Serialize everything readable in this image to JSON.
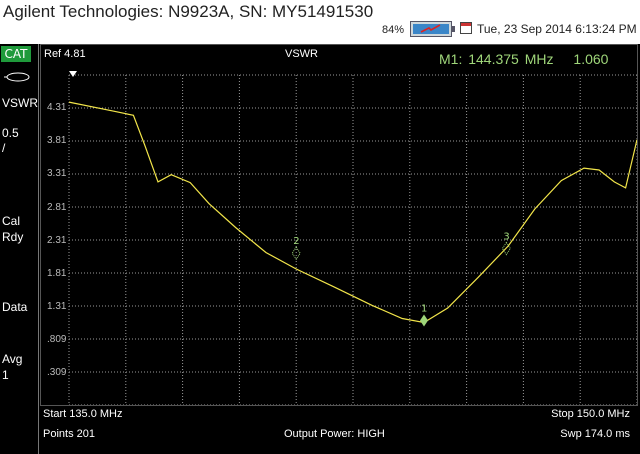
{
  "title_bar": {
    "app_title": "Agilent Technologies: N9923A, SN: MY51491530",
    "battery_percent": "84%",
    "datetime": "Tue, 23 Sep 2014 6:13:24 PM"
  },
  "sidebar": {
    "cat_label": "CAT",
    "format_label": "VSWR",
    "scale_line1": "0.5",
    "scale_line2": "/",
    "cal_line1": "Cal",
    "cal_line2": "Rdy",
    "data_label": "Data",
    "avg_line1": "Avg",
    "avg_line2": "1"
  },
  "plot": {
    "ref_label": "Ref 4.81",
    "mode_label": "VSWR",
    "marker_readout": {
      "marker": "M1:",
      "frequency": "144.375 MHz",
      "value": "1.060"
    },
    "y_ticks": [
      "4.31",
      "3.81",
      "3.31",
      "2.81",
      "2.31",
      "1.81",
      "1.31",
      ".809",
      ".309"
    ],
    "marker_labels": [
      "1",
      "2",
      "3"
    ]
  },
  "chart_data": {
    "type": "line",
    "ylim": [
      -0.19,
      4.81
    ],
    "xlim": [
      135.0,
      150.0
    ],
    "x": [
      135.0,
      136.2,
      136.7,
      137.0,
      137.35,
      137.7,
      138.2,
      138.7,
      139.4,
      140.2,
      141.0,
      142.0,
      143.0,
      143.8,
      144.375,
      145.0,
      145.8,
      146.6,
      147.3,
      148.0,
      148.6,
      149.0,
      149.4,
      149.7,
      150.0
    ],
    "series": [
      {
        "values": [
          4.4,
          4.26,
          4.2,
          3.75,
          3.19,
          3.3,
          3.18,
          2.86,
          2.5,
          2.12,
          1.87,
          1.6,
          1.32,
          1.12,
          1.06,
          1.28,
          1.74,
          2.22,
          2.78,
          3.21,
          3.4,
          3.37,
          3.19,
          3.1,
          3.83
        ]
      }
    ],
    "markers": [
      {
        "label": "1",
        "x": 144.375,
        "y": 1.06
      },
      {
        "label": "2",
        "x": 141.0,
        "y": 2.08
      },
      {
        "label": "3",
        "x": 146.55,
        "y": 2.15
      }
    ]
  },
  "footer": {
    "start": "Start 135.0 MHz",
    "stop": "Stop 150.0 MHz",
    "points": "Points 201",
    "output_power": "Output Power: HIGH",
    "sweep": "Swp 174.0 ms"
  },
  "colors": {
    "trace": "#f2e54a",
    "marker": "#9fd67a",
    "grid": "#9a9a9a",
    "cat_badge": "#1f9a3b"
  }
}
